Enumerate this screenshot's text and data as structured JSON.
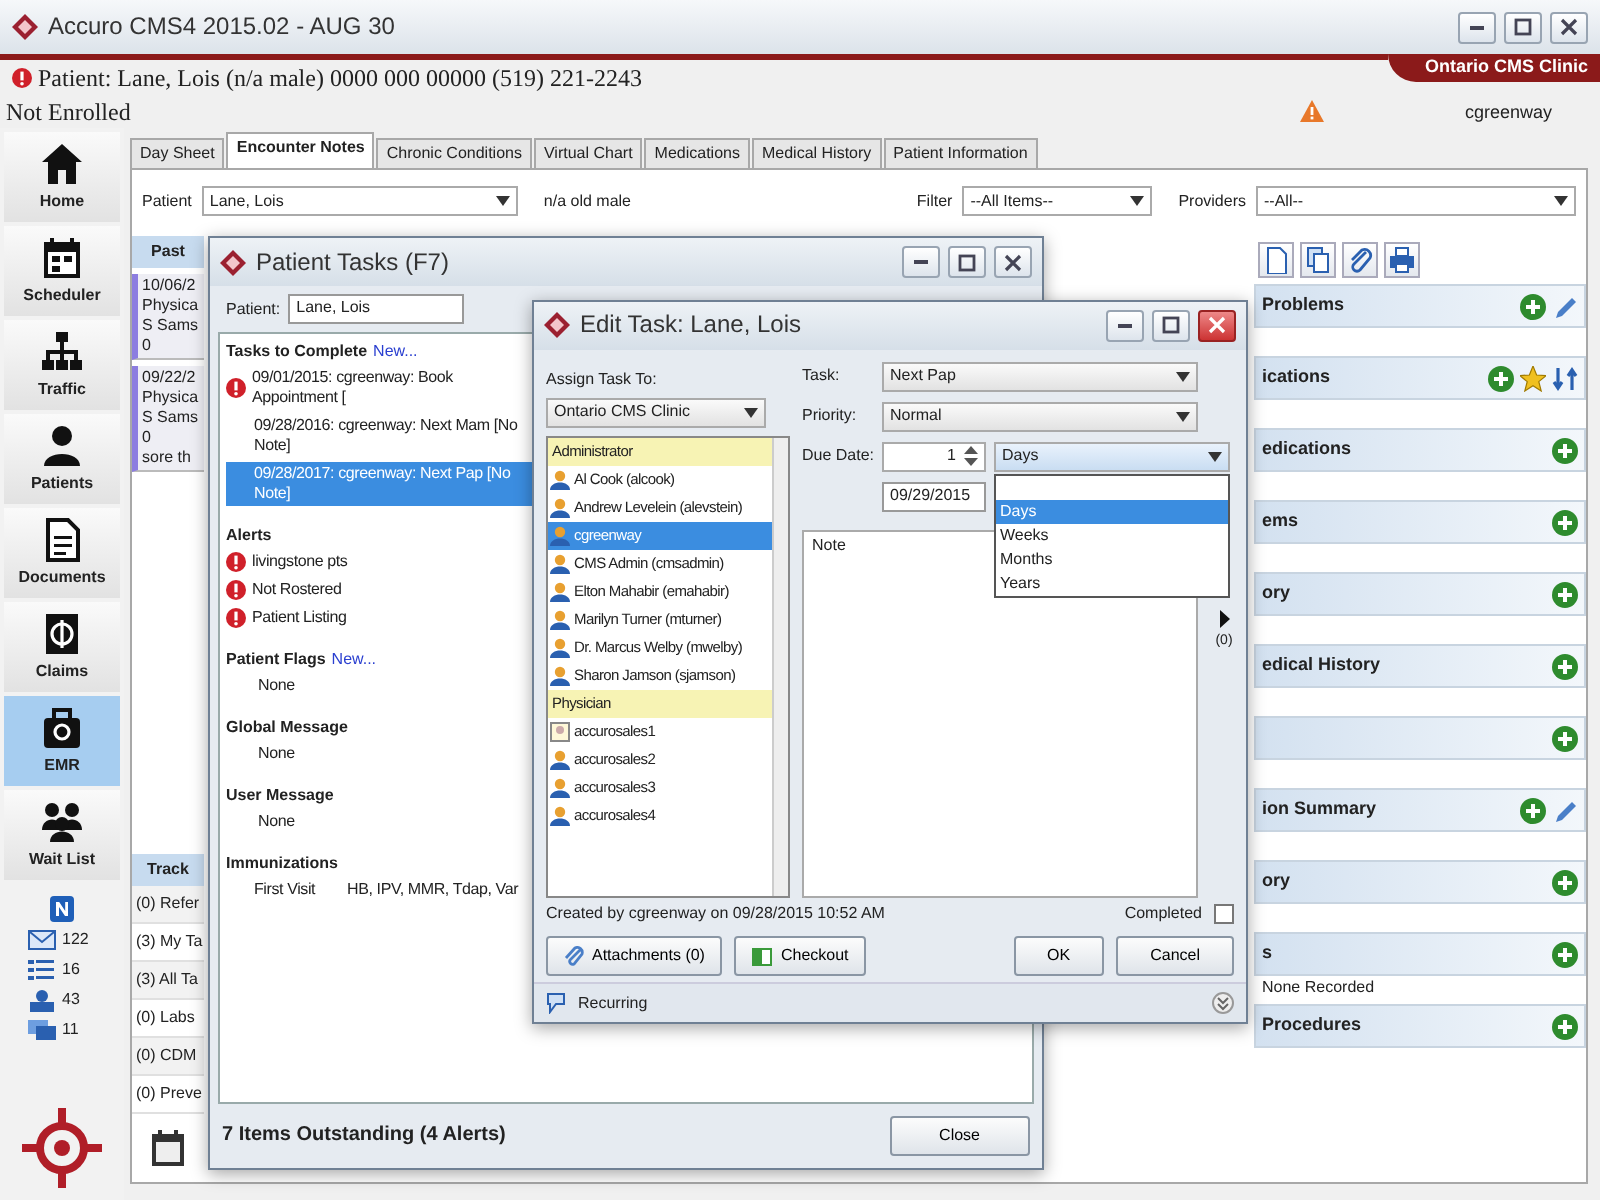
{
  "window": {
    "title": "Accuro CMS4 2015.02 - AUG 30",
    "clinic": "Ontario CMS Clinic"
  },
  "patient_banner": {
    "summary": "Patient: Lane, Lois  (n/a male) 0000 000 00000 (519) 221-2243",
    "enrollment": "Not Enrolled",
    "user": "cgreenway"
  },
  "sidebar": {
    "items": [
      {
        "kind": "home",
        "label": "Home",
        "selected": false
      },
      {
        "kind": "calendar",
        "label": "Scheduler",
        "selected": false
      },
      {
        "kind": "tree",
        "label": "Traffic",
        "selected": false
      },
      {
        "kind": "person",
        "label": "Patients",
        "selected": false
      },
      {
        "kind": "document",
        "label": "Documents",
        "selected": false
      },
      {
        "kind": "bill",
        "label": "Claims",
        "selected": false
      },
      {
        "kind": "bag",
        "label": "EMR",
        "selected": true
      },
      {
        "kind": "group",
        "label": "Wait List",
        "selected": false
      }
    ],
    "counters": [
      {
        "kind": "mail",
        "count": "122"
      },
      {
        "kind": "list",
        "count": "16"
      },
      {
        "kind": "inbox",
        "count": "43"
      },
      {
        "kind": "chat",
        "count": "11"
      }
    ]
  },
  "tabs": [
    {
      "label": "Day Sheet",
      "selected": false
    },
    {
      "label": "Encounter Notes",
      "selected": true
    },
    {
      "label": "Chronic Conditions",
      "selected": false
    },
    {
      "label": "Virtual Chart",
      "selected": false
    },
    {
      "label": "Medications",
      "selected": false
    },
    {
      "label": "Medical History",
      "selected": false
    },
    {
      "label": "Patient Information",
      "selected": false
    }
  ],
  "filter_bar": {
    "patient_label": "Patient",
    "patient": "Lane, Lois",
    "patient_info": "n/a old male",
    "filter_label": "Filter",
    "filter": "--All Items--",
    "providers_label": "Providers",
    "providers": "--All--"
  },
  "encounters": {
    "header": "Past",
    "entries": [
      {
        "lines": [
          "10/06/2",
          "Physica",
          "S Sams",
          "0"
        ]
      },
      {
        "lines": [
          "09/22/2",
          "Physica",
          "S Sams",
          "0",
          "sore th"
        ]
      }
    ]
  },
  "tracking": {
    "header": "Track",
    "items": [
      "(0) Refer",
      "(3) My Ta",
      "(3) All Ta",
      "(0) Labs",
      "(0) CDM",
      "(0) Preve"
    ]
  },
  "summary_panel": {
    "sections": [
      {
        "kind": "edit",
        "title": "Problems"
      },
      {
        "kind": "favorites",
        "title": "ications"
      },
      {
        "kind": "add",
        "title": "edications"
      },
      {
        "kind": "add",
        "title": "ems"
      },
      {
        "kind": "add",
        "title": "ory"
      },
      {
        "kind": "add",
        "title": "edical History"
      },
      {
        "kind": "add"
      },
      {
        "kind": "edit",
        "title": "ion Summary"
      },
      {
        "kind": "add",
        "title": "ory"
      },
      {
        "kind": "add",
        "title": "s",
        "entries": [
          "None Recorded"
        ]
      },
      {
        "kind": "add",
        "title": "Procedures"
      }
    ]
  },
  "patient_tasks": {
    "title": "Patient Tasks (F7)",
    "patient_label": "Patient:",
    "patient": "Lane, Lois",
    "sections": [
      {
        "title": "Tasks to Complete",
        "link": "New...",
        "items": [
          {
            "text": "09/01/2015: cgreenway: Book Appointment [",
            "alert": true,
            "selected": false
          },
          {
            "text": "09/28/2016: cgreenway: Next Mam [No Note]",
            "alert": false,
            "selected": false
          },
          {
            "text": "09/28/2017: cgreenway: Next Pap [No Note]",
            "alert": false,
            "selected": true
          }
        ]
      },
      {
        "title": "Alerts",
        "items": [
          {
            "text": "livingstone pts",
            "alert": true
          },
          {
            "text": "Not Rostered",
            "alert": true
          },
          {
            "text": "Patient Listing",
            "alert": true
          }
        ]
      },
      {
        "title": "Patient Flags",
        "link": "New...",
        "items": [
          {
            "text": "None",
            "alert": false
          }
        ]
      },
      {
        "title": "Global Message",
        "items": [
          {
            "text": "None",
            "alert": false
          }
        ]
      },
      {
        "title": "User Message",
        "items": [
          {
            "text": "None",
            "alert": false
          }
        ]
      },
      {
        "title": "Immunizations",
        "items": [
          {
            "text": "First Visit",
            "detail": "HB, IPV, MMR, Tdap, Var",
            "alert": false
          }
        ]
      }
    ],
    "footer": "7 Items Outstanding (4 Alerts)",
    "close": "Close"
  },
  "edit_task": {
    "title": "Edit Task: Lane, Lois",
    "assign_label": "Assign Task To:",
    "assign_to": "Ontario CMS Clinic",
    "users": [
      {
        "kind": "group",
        "text": "Administrator"
      },
      {
        "kind": "user",
        "text": "Al Cook (alcook)",
        "selected": false
      },
      {
        "kind": "user",
        "text": "Andrew Levelein (alevstein)",
        "selected": false
      },
      {
        "kind": "user",
        "text": "cgreenway",
        "selected": true
      },
      {
        "kind": "user",
        "text": "CMS Admin (cmsadmin)",
        "selected": false
      },
      {
        "kind": "user",
        "text": "Elton Mahabir (emahabir)",
        "selected": false
      },
      {
        "kind": "user",
        "text": "Marilyn Turner (mturner)",
        "selected": false
      },
      {
        "kind": "user",
        "text": "Dr. Marcus Welby (mwelby)",
        "selected": false
      },
      {
        "kind": "user",
        "text": "Sharon Jamson (sjamson)",
        "selected": false
      },
      {
        "kind": "group",
        "text": "Physician"
      },
      {
        "kind": "generic",
        "text": "accurosales1",
        "selected": false
      },
      {
        "kind": "user",
        "text": "accurosales2",
        "selected": false
      },
      {
        "kind": "user",
        "text": "accurosales3",
        "selected": false
      },
      {
        "kind": "user",
        "text": "accurosales4",
        "selected": false
      }
    ],
    "task_label": "Task:",
    "task": "Next Pap",
    "priority_label": "Priority:",
    "priority": "Normal",
    "due_label": "Due Date:",
    "due_count": "1",
    "due_unit": "Days",
    "unit_options": [
      {
        "text": "Days",
        "selected": true
      },
      {
        "text": "Weeks",
        "selected": false
      },
      {
        "text": "Months",
        "selected": false
      },
      {
        "text": "Years",
        "selected": false
      }
    ],
    "due_date": "09/29/2015",
    "note_label": "Note",
    "side_count": "(0)",
    "created": "Created by cgreenway on 09/28/2015 10:52 AM",
    "completed_label": "Completed",
    "completed": false,
    "attachments": "Attachments (0)",
    "checkout": "Checkout",
    "ok": "OK",
    "cancel": "Cancel",
    "recurring": "Recurring"
  }
}
